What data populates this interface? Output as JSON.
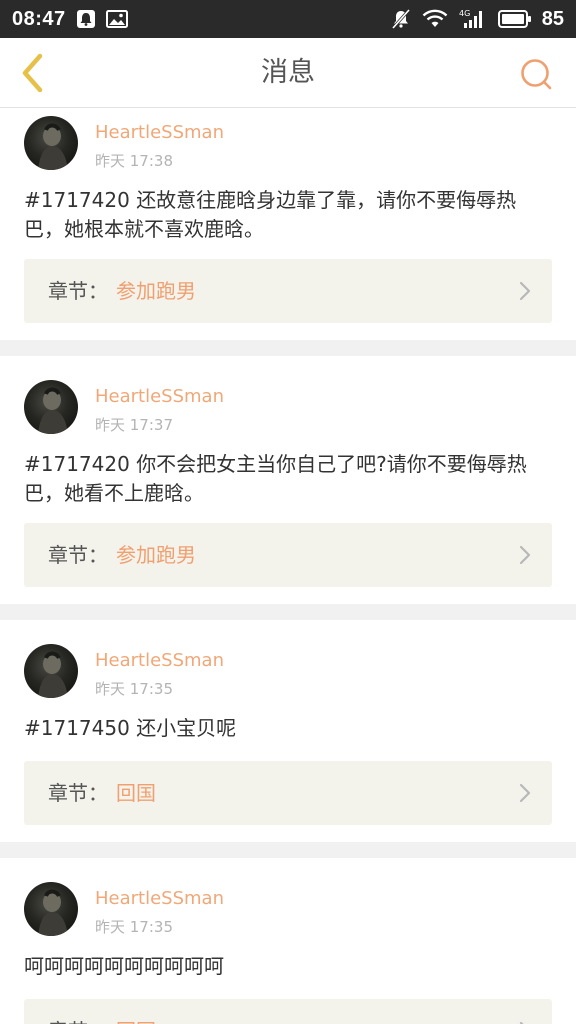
{
  "status_bar": {
    "time": "08:47",
    "network": "4G",
    "battery": "85"
  },
  "header": {
    "title": "消息"
  },
  "messages": [
    {
      "username": "HeartleSSman",
      "time": "昨天 17:38",
      "content": "#1717420 还故意往鹿晗身边靠了靠，请你不要侮辱热巴，她根本就不喜欢鹿晗。",
      "chapter_label": "章节：",
      "chapter_name": "参加跑男"
    },
    {
      "username": "HeartleSSman",
      "time": "昨天 17:37",
      "content": "#1717420 你不会把女主当你自己了吧?请你不要侮辱热巴，她看不上鹿晗。",
      "chapter_label": "章节：",
      "chapter_name": "参加跑男"
    },
    {
      "username": "HeartleSSman",
      "time": "昨天 17:35",
      "content": "#1717450 还小宝贝呢",
      "chapter_label": "章节：",
      "chapter_name": "回国"
    },
    {
      "username": "HeartleSSman",
      "time": "昨天 17:35",
      "content": "呵呵呵呵呵呵呵呵呵呵",
      "chapter_label": "章节：",
      "chapter_name": "回国"
    }
  ],
  "colors": {
    "accent": "#f0a070",
    "username": "#f0a878",
    "status_bar_bg": "#2a2a2a",
    "chapter_bg": "#f3f3ec"
  },
  "icons": {
    "back": "chevron-left-icon",
    "search": "search-icon"
  }
}
